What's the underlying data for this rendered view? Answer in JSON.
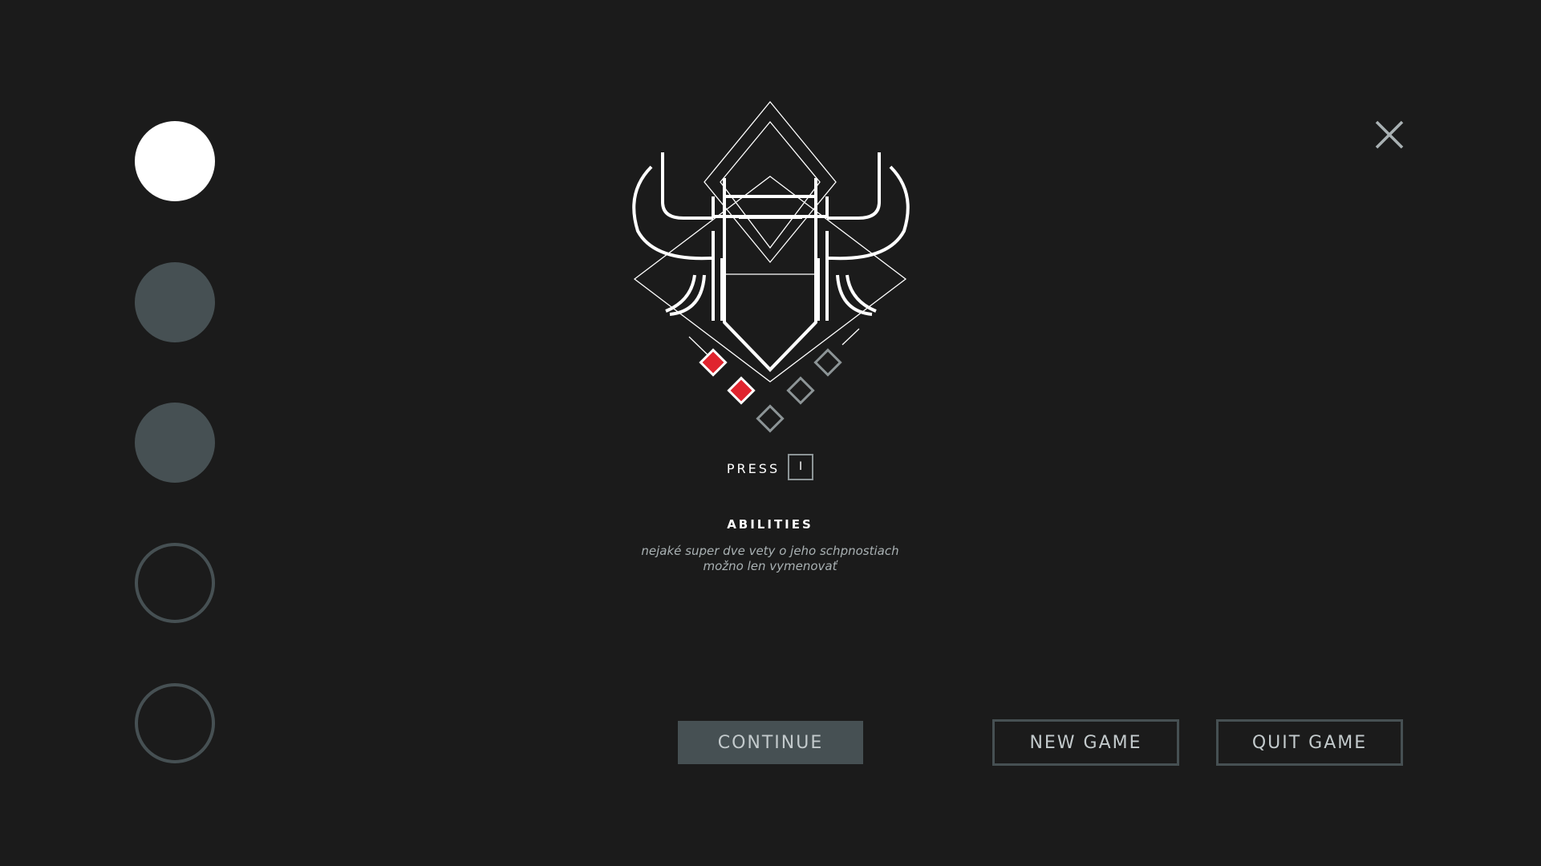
{
  "save_slots": [
    {
      "state": "active"
    },
    {
      "state": "used"
    },
    {
      "state": "used"
    },
    {
      "state": "empty"
    },
    {
      "state": "empty"
    }
  ],
  "close_icon": "close-icon",
  "emblem": {
    "icon": "horned-helmet-emblem",
    "colors": {
      "line": "#ffffff",
      "accent": "#e0242e",
      "muted": "#8c9496"
    },
    "ability_pips": {
      "filled": 2,
      "total": 5
    }
  },
  "prompt": {
    "label": "PRESS",
    "key": "I"
  },
  "ability": {
    "title": "ABILITIES",
    "description": "nejaké super dve vety o jeho schpnostiach\nmožno len vymenovať"
  },
  "menu": {
    "continue_label": "CONTINUE",
    "new_game_label": "NEW GAME",
    "quit_game_label": "QUIT GAME"
  },
  "colors": {
    "background": "#1b1b1b",
    "slot_fill": "#465053",
    "active": "#ffffff",
    "button_text": "#c3cacc"
  }
}
